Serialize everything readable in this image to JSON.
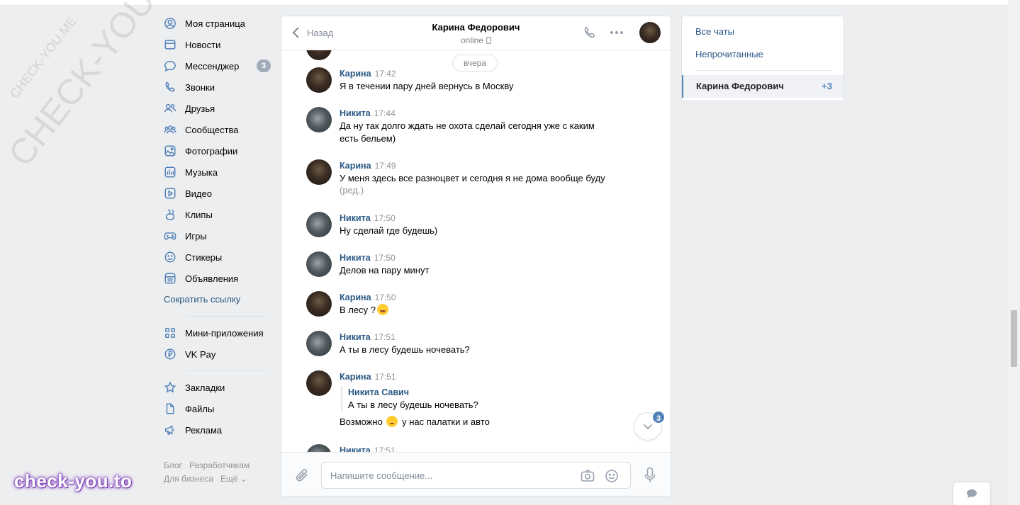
{
  "left_nav": {
    "items": [
      {
        "label": "Моя страница",
        "icon": "user-circle-icon"
      },
      {
        "label": "Новости",
        "icon": "newspaper-icon"
      },
      {
        "label": "Мессенджер",
        "icon": "chat-bubble-icon",
        "badge": "3"
      },
      {
        "label": "Звонки",
        "icon": "phone-icon"
      },
      {
        "label": "Друзья",
        "icon": "friends-icon"
      },
      {
        "label": "Сообщества",
        "icon": "communities-icon"
      },
      {
        "label": "Фотографии",
        "icon": "photo-icon"
      },
      {
        "label": "Музыка",
        "icon": "music-icon"
      },
      {
        "label": "Видео",
        "icon": "video-icon"
      },
      {
        "label": "Клипы",
        "icon": "clips-icon"
      },
      {
        "label": "Игры",
        "icon": "gamepad-icon"
      },
      {
        "label": "Стикеры",
        "icon": "smile-icon"
      },
      {
        "label": "Объявления",
        "icon": "classifieds-icon"
      }
    ],
    "shorten_link": "Сократить ссылку",
    "apps": [
      {
        "label": "Мини-приложения",
        "icon": "grid-icon"
      },
      {
        "label": "VK Pay",
        "icon": "ruble-icon"
      }
    ],
    "extras": [
      {
        "label": "Закладки",
        "icon": "star-icon"
      },
      {
        "label": "Файлы",
        "icon": "file-icon"
      },
      {
        "label": "Реклама",
        "icon": "megaphone-icon"
      }
    ],
    "footer": {
      "blog": "Блог",
      "developers": "Разработчикам",
      "business": "Для бизнеса",
      "more": "Ещё ⌄"
    }
  },
  "watermark": {
    "big": "CHECK-YOU.ME",
    "small": "CHECK-YOU.ME",
    "brand": "check-you.to"
  },
  "chat": {
    "back_label": "Назад",
    "peer_name": "Карина Федорович",
    "peer_status": "online",
    "date_separator": "вчера",
    "messages": [
      {
        "author": "Карина",
        "time": "17:42",
        "text": "Я в течении пару дней вернусь в Москву"
      },
      {
        "author": "Никита",
        "time": "17:44",
        "text": "Да ну так долго ждать не охота сделай сегодня уже с каким есть бельем)"
      },
      {
        "author": "Карина",
        "time": "17:49",
        "text": "У меня здесь все разноцвет и сегодня я не дома вообще буду",
        "edited": "(ред.)"
      },
      {
        "author": "Никита",
        "time": "17:50",
        "text": "Ну сделай где будешь)"
      },
      {
        "author": "Никита",
        "time": "17:50",
        "text": "Делов на пару минут"
      },
      {
        "author": "Карина",
        "time": "17:50",
        "text": "В лесу ?"
      },
      {
        "author": "Никита",
        "time": "17:51",
        "text": "А ты в лесу будешь ночевать?"
      },
      {
        "author": "Карина",
        "time": "17:51",
        "reply_name": "Никита Савич",
        "reply_text": "А ты в лесу будешь ночевать?",
        "text_before": "Возможно",
        "text_after": "у нас палатки и авто"
      },
      {
        "author": "Никита",
        "time": "17:51"
      }
    ],
    "unread_badge": "3",
    "composer_placeholder": "Напишите сообщение..."
  },
  "right_panel": {
    "all_chats": "Все чаты",
    "unread": "Непрочитанные",
    "active_chat": "Карина Федорович",
    "active_count": "+3"
  },
  "colors": {
    "accent": "#5181b8",
    "link": "#2a5885",
    "background": "#edeef0"
  }
}
